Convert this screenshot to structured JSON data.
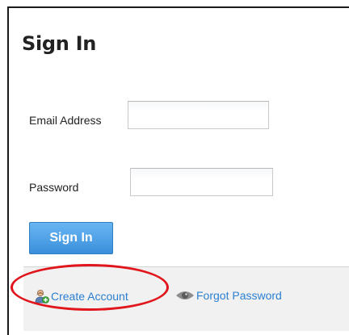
{
  "form": {
    "title": "Sign In",
    "email_label": "Email Address",
    "email_value": "",
    "password_label": "Password",
    "password_value": "",
    "submit_label": "Sign In"
  },
  "footer": {
    "create_account_label": "Create Account",
    "create_account_icon": "user-add-icon",
    "forgot_password_label": "Forgot Password",
    "forgot_password_icon": "eye-icon"
  },
  "annotation": {
    "highlight_color": "#e0161c",
    "highlight_target": "create-account-link"
  },
  "colors": {
    "link": "#2a7fd2",
    "button": "#3a8fdb",
    "footer_bg": "#f1f1f1"
  }
}
